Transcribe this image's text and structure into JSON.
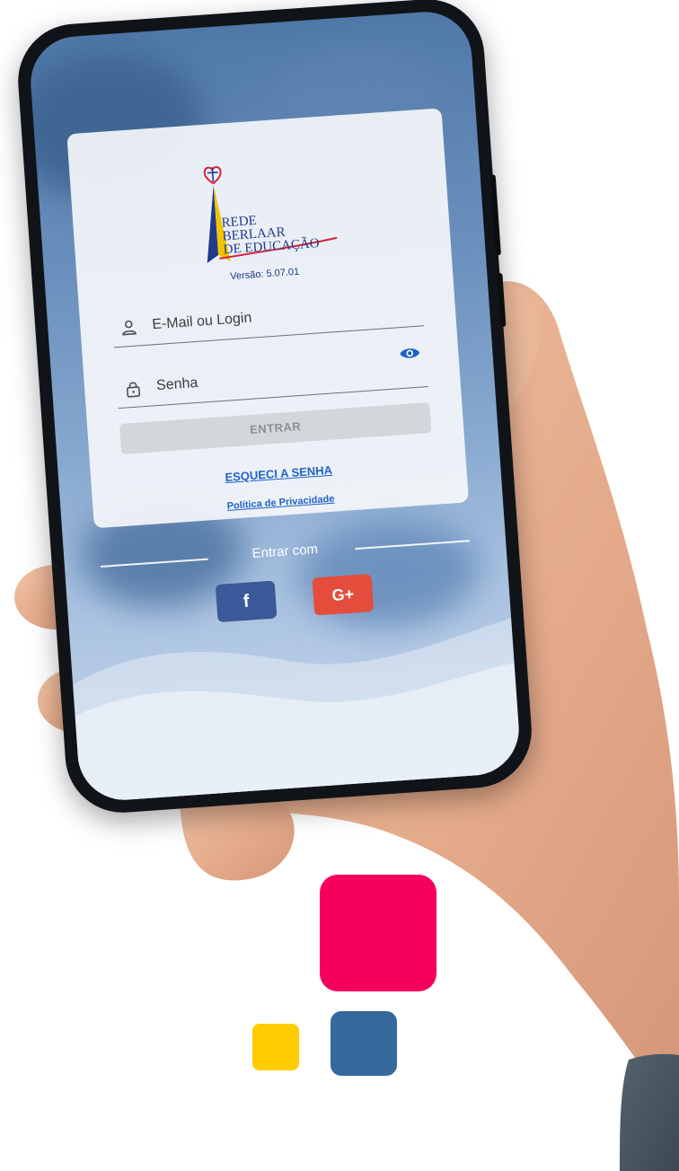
{
  "brand": {
    "logo_text": "REDE\nBERLAAR\nDE EDUCAÇÃO",
    "version": "Versão: 5.07.01"
  },
  "login_form": {
    "login_placeholder": "E-Mail ou Login",
    "password_placeholder": "Senha",
    "submit_label": "ENTRAR",
    "forgot_password": "ESQUECI A SENHA",
    "privacy_policy": "Política de Privacidade"
  },
  "social_login": {
    "label": "Entrar com",
    "facebook_label": "f",
    "google_label": "G+"
  },
  "colors": {
    "accent_pink": "#f6005e",
    "accent_blue": "#35699b",
    "accent_yellow": "#ffcc00",
    "link_blue": "#1f62c9",
    "facebook": "#3b5998",
    "google": "#e44c3c"
  }
}
